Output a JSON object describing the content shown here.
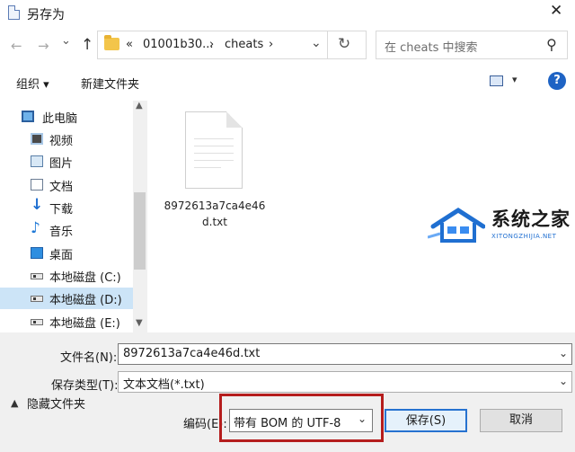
{
  "window": {
    "title": "另存为",
    "close_glyph": "✕"
  },
  "nav": {
    "back_glyph": "←",
    "forward_glyph": "→",
    "dropdown_glyph": "⌄",
    "up_glyph": "↑",
    "address": {
      "overflow": "«",
      "segment1": "01001b30...",
      "arrow1": "›",
      "segment2": "cheats",
      "arrow2": "›",
      "chevron": "⌄"
    },
    "refresh_glyph": "↻",
    "search_placeholder": "在 cheats 中搜索",
    "search_glyph": "⚲"
  },
  "toolbar": {
    "organize": "组织 ▾",
    "new_folder": "新建文件夹",
    "view_chevron": "▾",
    "help": "?"
  },
  "sidebar": {
    "items": [
      {
        "label": "此电脑",
        "icon": "computer-icon"
      },
      {
        "label": "视频",
        "icon": "video-icon"
      },
      {
        "label": "图片",
        "icon": "pictures-icon"
      },
      {
        "label": "文档",
        "icon": "documents-icon"
      },
      {
        "label": "下载",
        "icon": "download-icon"
      },
      {
        "label": "音乐",
        "icon": "music-icon"
      },
      {
        "label": "桌面",
        "icon": "desktop-icon"
      },
      {
        "label": "本地磁盘 (C:)",
        "icon": "drive-icon"
      },
      {
        "label": "本地磁盘 (D:)",
        "icon": "drive-icon",
        "selected": true
      },
      {
        "label": "本地磁盘 (E:)",
        "icon": "drive-icon"
      }
    ],
    "scroll_up": "▲",
    "scroll_down": "▼"
  },
  "files": [
    {
      "name": "8972613a7ca4e46d.txt",
      "icon": "text-file-icon"
    }
  ],
  "watermark": {
    "text": "系统之家",
    "sub": "XITONGZHIJIA.NET"
  },
  "form": {
    "filename_label": "文件名(N):",
    "filename_value": "8972613a7ca4e46d.txt",
    "filetype_label": "保存类型(T):",
    "filetype_value": "文本文档(*.txt)",
    "hide_folders": "隐藏文件夹",
    "hide_chevron": "▲",
    "encoding_label": "编码(E):",
    "encoding_value": "带有 BOM 的 UTF-8",
    "chevron": "⌄",
    "save_button": "保存(S)",
    "cancel_button": "取消"
  },
  "colors": {
    "accent": "#2672d0",
    "highlight_box": "#b51d1d",
    "selection": "#cce4f7",
    "help": "#1e63c4"
  }
}
